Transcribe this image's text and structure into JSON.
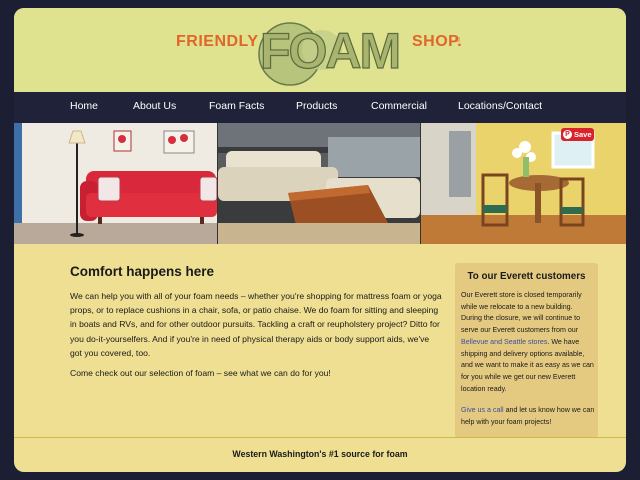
{
  "logo": {
    "left_word": "FRIENDLY",
    "center_word": "FOAM",
    "right_word": "SHOP.",
    "registered": "®"
  },
  "nav": {
    "items": [
      {
        "label": "Home"
      },
      {
        "label": "About Us"
      },
      {
        "label": "Foam Facts"
      },
      {
        "label": "Products"
      },
      {
        "label": "Commercial"
      },
      {
        "label": "Locations/Contact"
      }
    ]
  },
  "hero": {
    "save_button": "Save",
    "save_icon": "P"
  },
  "main": {
    "heading": "Comfort happens here",
    "intro": "We can help you with all of your foam needs – whether you're shopping for mattress foam or yoga props, or to replace cushions in a chair, sofa, or patio chaise. We do foam for sitting and sleeping in boats and RVs, and for other outdoor pursuits. Tackling a craft or reupholstery project? Ditto for you do-it-yourselfers. And if you're in need of physical therapy aids or body support aids, we've got you covered, too.",
    "cta": "Come check out our selection of foam – see what we can do for you!"
  },
  "sidebar": {
    "heading": "To our Everett customers",
    "p1_before": "Our Everett store is closed temporarily while we relocate to a new building. During the closure, we will continue to serve our Everett customers from our ",
    "p1_link": "Bellevue and Seattle stores",
    "p1_after": ". We have shipping and delivery options available, and we want to make it as easy as we can for you while we get our new Everett location ready.",
    "p2_link": "Give us a call",
    "p2_after": " and let us know how we can help with your foam projects!"
  },
  "footer": {
    "tagline": "Western Washington's #1 source for foam"
  },
  "colors": {
    "header_bg": "#dfe28f",
    "nav_bg": "#1f2238",
    "content_bg": "#eedf93",
    "accent_orange": "#e0662a",
    "link_blue": "#3d4fa0",
    "sidebar_bg": "#e4c980"
  }
}
